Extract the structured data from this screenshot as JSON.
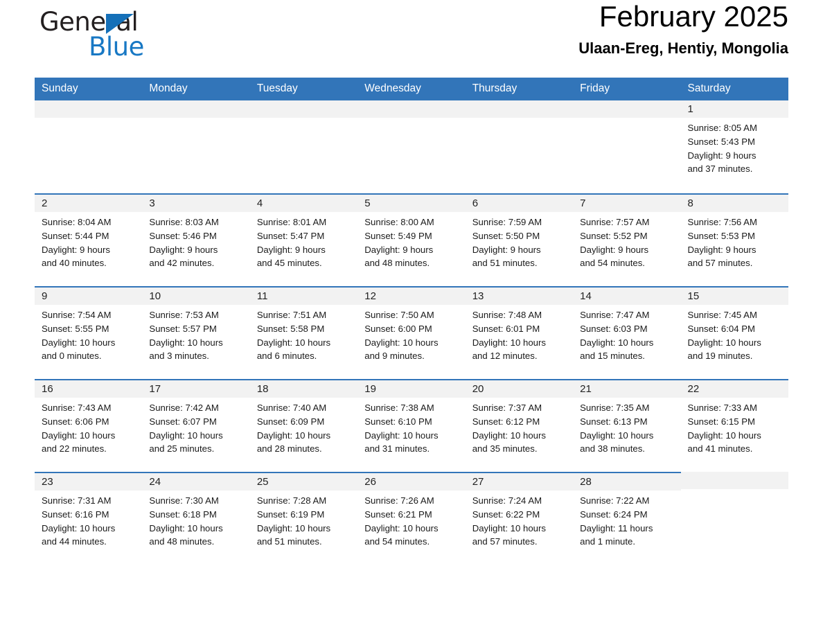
{
  "brand": {
    "word_one": "General",
    "word_two": "Blue",
    "triangle_color": "#1570b8",
    "blue_color": "#1878c4"
  },
  "header": {
    "title": "February 2025",
    "subtitle": "Ulaan-Ereg, Hentiy, Mongolia"
  },
  "theme": {
    "header_blue": "#3275b9",
    "day_band_gray": "#f2f2f2"
  },
  "weekday_headers": [
    "Sunday",
    "Monday",
    "Tuesday",
    "Wednesday",
    "Thursday",
    "Friday",
    "Saturday"
  ],
  "weeks": [
    [
      {
        "day": "",
        "sunrise": "",
        "sunset": "",
        "daylight_line1": "",
        "daylight_line2": ""
      },
      {
        "day": "",
        "sunrise": "",
        "sunset": "",
        "daylight_line1": "",
        "daylight_line2": ""
      },
      {
        "day": "",
        "sunrise": "",
        "sunset": "",
        "daylight_line1": "",
        "daylight_line2": ""
      },
      {
        "day": "",
        "sunrise": "",
        "sunset": "",
        "daylight_line1": "",
        "daylight_line2": ""
      },
      {
        "day": "",
        "sunrise": "",
        "sunset": "",
        "daylight_line1": "",
        "daylight_line2": ""
      },
      {
        "day": "",
        "sunrise": "",
        "sunset": "",
        "daylight_line1": "",
        "daylight_line2": ""
      },
      {
        "day": "1",
        "sunrise": "Sunrise: 8:05 AM",
        "sunset": "Sunset: 5:43 PM",
        "daylight_line1": "Daylight: 9 hours",
        "daylight_line2": "and 37 minutes."
      }
    ],
    [
      {
        "day": "2",
        "sunrise": "Sunrise: 8:04 AM",
        "sunset": "Sunset: 5:44 PM",
        "daylight_line1": "Daylight: 9 hours",
        "daylight_line2": "and 40 minutes."
      },
      {
        "day": "3",
        "sunrise": "Sunrise: 8:03 AM",
        "sunset": "Sunset: 5:46 PM",
        "daylight_line1": "Daylight: 9 hours",
        "daylight_line2": "and 42 minutes."
      },
      {
        "day": "4",
        "sunrise": "Sunrise: 8:01 AM",
        "sunset": "Sunset: 5:47 PM",
        "daylight_line1": "Daylight: 9 hours",
        "daylight_line2": "and 45 minutes."
      },
      {
        "day": "5",
        "sunrise": "Sunrise: 8:00 AM",
        "sunset": "Sunset: 5:49 PM",
        "daylight_line1": "Daylight: 9 hours",
        "daylight_line2": "and 48 minutes."
      },
      {
        "day": "6",
        "sunrise": "Sunrise: 7:59 AM",
        "sunset": "Sunset: 5:50 PM",
        "daylight_line1": "Daylight: 9 hours",
        "daylight_line2": "and 51 minutes."
      },
      {
        "day": "7",
        "sunrise": "Sunrise: 7:57 AM",
        "sunset": "Sunset: 5:52 PM",
        "daylight_line1": "Daylight: 9 hours",
        "daylight_line2": "and 54 minutes."
      },
      {
        "day": "8",
        "sunrise": "Sunrise: 7:56 AM",
        "sunset": "Sunset: 5:53 PM",
        "daylight_line1": "Daylight: 9 hours",
        "daylight_line2": "and 57 minutes."
      }
    ],
    [
      {
        "day": "9",
        "sunrise": "Sunrise: 7:54 AM",
        "sunset": "Sunset: 5:55 PM",
        "daylight_line1": "Daylight: 10 hours",
        "daylight_line2": "and 0 minutes."
      },
      {
        "day": "10",
        "sunrise": "Sunrise: 7:53 AM",
        "sunset": "Sunset: 5:57 PM",
        "daylight_line1": "Daylight: 10 hours",
        "daylight_line2": "and 3 minutes."
      },
      {
        "day": "11",
        "sunrise": "Sunrise: 7:51 AM",
        "sunset": "Sunset: 5:58 PM",
        "daylight_line1": "Daylight: 10 hours",
        "daylight_line2": "and 6 minutes."
      },
      {
        "day": "12",
        "sunrise": "Sunrise: 7:50 AM",
        "sunset": "Sunset: 6:00 PM",
        "daylight_line1": "Daylight: 10 hours",
        "daylight_line2": "and 9 minutes."
      },
      {
        "day": "13",
        "sunrise": "Sunrise: 7:48 AM",
        "sunset": "Sunset: 6:01 PM",
        "daylight_line1": "Daylight: 10 hours",
        "daylight_line2": "and 12 minutes."
      },
      {
        "day": "14",
        "sunrise": "Sunrise: 7:47 AM",
        "sunset": "Sunset: 6:03 PM",
        "daylight_line1": "Daylight: 10 hours",
        "daylight_line2": "and 15 minutes."
      },
      {
        "day": "15",
        "sunrise": "Sunrise: 7:45 AM",
        "sunset": "Sunset: 6:04 PM",
        "daylight_line1": "Daylight: 10 hours",
        "daylight_line2": "and 19 minutes."
      }
    ],
    [
      {
        "day": "16",
        "sunrise": "Sunrise: 7:43 AM",
        "sunset": "Sunset: 6:06 PM",
        "daylight_line1": "Daylight: 10 hours",
        "daylight_line2": "and 22 minutes."
      },
      {
        "day": "17",
        "sunrise": "Sunrise: 7:42 AM",
        "sunset": "Sunset: 6:07 PM",
        "daylight_line1": "Daylight: 10 hours",
        "daylight_line2": "and 25 minutes."
      },
      {
        "day": "18",
        "sunrise": "Sunrise: 7:40 AM",
        "sunset": "Sunset: 6:09 PM",
        "daylight_line1": "Daylight: 10 hours",
        "daylight_line2": "and 28 minutes."
      },
      {
        "day": "19",
        "sunrise": "Sunrise: 7:38 AM",
        "sunset": "Sunset: 6:10 PM",
        "daylight_line1": "Daylight: 10 hours",
        "daylight_line2": "and 31 minutes."
      },
      {
        "day": "20",
        "sunrise": "Sunrise: 7:37 AM",
        "sunset": "Sunset: 6:12 PM",
        "daylight_line1": "Daylight: 10 hours",
        "daylight_line2": "and 35 minutes."
      },
      {
        "day": "21",
        "sunrise": "Sunrise: 7:35 AM",
        "sunset": "Sunset: 6:13 PM",
        "daylight_line1": "Daylight: 10 hours",
        "daylight_line2": "and 38 minutes."
      },
      {
        "day": "22",
        "sunrise": "Sunrise: 7:33 AM",
        "sunset": "Sunset: 6:15 PM",
        "daylight_line1": "Daylight: 10 hours",
        "daylight_line2": "and 41 minutes."
      }
    ],
    [
      {
        "day": "23",
        "sunrise": "Sunrise: 7:31 AM",
        "sunset": "Sunset: 6:16 PM",
        "daylight_line1": "Daylight: 10 hours",
        "daylight_line2": "and 44 minutes."
      },
      {
        "day": "24",
        "sunrise": "Sunrise: 7:30 AM",
        "sunset": "Sunset: 6:18 PM",
        "daylight_line1": "Daylight: 10 hours",
        "daylight_line2": "and 48 minutes."
      },
      {
        "day": "25",
        "sunrise": "Sunrise: 7:28 AM",
        "sunset": "Sunset: 6:19 PM",
        "daylight_line1": "Daylight: 10 hours",
        "daylight_line2": "and 51 minutes."
      },
      {
        "day": "26",
        "sunrise": "Sunrise: 7:26 AM",
        "sunset": "Sunset: 6:21 PM",
        "daylight_line1": "Daylight: 10 hours",
        "daylight_line2": "and 54 minutes."
      },
      {
        "day": "27",
        "sunrise": "Sunrise: 7:24 AM",
        "sunset": "Sunset: 6:22 PM",
        "daylight_line1": "Daylight: 10 hours",
        "daylight_line2": "and 57 minutes."
      },
      {
        "day": "28",
        "sunrise": "Sunrise: 7:22 AM",
        "sunset": "Sunset: 6:24 PM",
        "daylight_line1": "Daylight: 11 hours",
        "daylight_line2": "and 1 minute."
      },
      {
        "day": "",
        "sunrise": "",
        "sunset": "",
        "daylight_line1": "",
        "daylight_line2": ""
      }
    ]
  ]
}
